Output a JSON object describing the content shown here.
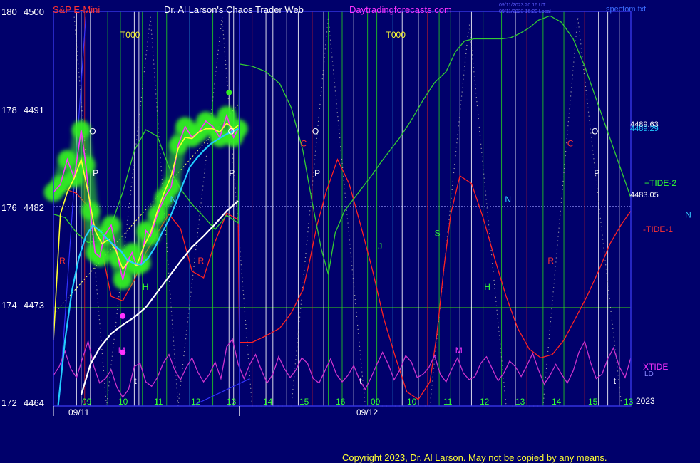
{
  "header": {
    "symbol": "S&P E-Mini",
    "title": "Dr. Al Larson's Chaos Trader Web",
    "site": "Daytradingforecasts.com",
    "stamp_ut": "09/11/2023 20:16 UT",
    "stamp_local": "09/11/2023 16:20 Local",
    "file": "spectom.txt"
  },
  "footer": {
    "copyright": "Copyright 2023, Dr. Al Larson. May not be copied by any means."
  },
  "colors": {
    "background": "#00006b",
    "border": "#3232e0",
    "candle": "#ff33ff",
    "ema_fast": "#ffff33",
    "ema_mid": "#22ccff",
    "ema_slow": "#ffffff",
    "tide1": "#ff2222",
    "tide2": "#33cc33",
    "xtide": "#cc33cc",
    "glow": "#33ee22",
    "grid_green": "#2a9a2a",
    "text_red": "#ff3333",
    "text_green": "#33ff33"
  },
  "chart_data": {
    "type": "line",
    "title": "S&P E-Mini",
    "xlabel": "",
    "ylabel": "",
    "dates": [
      "09/11",
      "09/12"
    ],
    "year": "2023",
    "x_ticks": [
      "09",
      "10",
      "11",
      "12",
      "13",
      "14",
      "15",
      "16",
      "09",
      "10",
      "11",
      "12",
      "13",
      "14",
      "15",
      "13"
    ],
    "x_range": [
      8.0,
      33.0
    ],
    "y_axis": {
      "left_labels": [
        "180",
        "178",
        "176",
        "174",
        "172"
      ],
      "right_labels": [
        "4500",
        "4491",
        "4482",
        "4473",
        "4464"
      ],
      "range": [
        4464,
        4500
      ]
    },
    "horizontal_line": {
      "value": 4482.2,
      "style": "dotted"
    },
    "price_labels": [
      "4489.63",
      "4489.29",
      "4483.05"
    ],
    "series": [
      {
        "name": "",
        "color": "#ff33ff",
        "x": [
          8.0,
          8.3,
          8.6,
          8.9,
          9.2,
          9.4,
          9.6,
          9.8,
          10.0,
          10.2,
          10.5,
          10.8,
          11.0,
          11.2,
          11.4,
          11.6,
          11.8,
          12.0,
          12.2,
          12.5,
          12.8,
          13.1,
          13.4,
          13.7,
          14.0,
          14.3,
          14.6,
          14.9,
          15.2,
          15.5,
          15.8,
          16.0
        ],
        "y": [
          4483.5,
          4484.2,
          4486.5,
          4484.8,
          4489.2,
          4486.0,
          4481.8,
          4478.0,
          4477.6,
          4479.5,
          4480.5,
          4477.5,
          4475.5,
          4477.2,
          4478.0,
          4476.8,
          4477.0,
          4480.0,
          4479.5,
          4481.5,
          4483.0,
          4484.0,
          4487.8,
          4489.5,
          4488.5,
          4489.0,
          4490.0,
          4489.5,
          4488.5,
          4490.5,
          4488.5,
          4489.3
        ]
      },
      {
        "name": "",
        "color": "#ffff33",
        "x": [
          8.0,
          8.3,
          8.6,
          8.9,
          9.2,
          9.5,
          9.8,
          10.1,
          10.4,
          10.7,
          11.0,
          11.3,
          11.6,
          11.9,
          12.2,
          12.5,
          12.8,
          13.1,
          13.4,
          13.7,
          14.0,
          14.3,
          14.6,
          14.9,
          15.2,
          15.5,
          15.8,
          16.0
        ],
        "y": [
          4470.0,
          4481.5,
          4483.5,
          4484.8,
          4486.5,
          4483.5,
          4480.0,
          4478.8,
          4479.2,
          4478.2,
          4476.5,
          4477.3,
          4476.8,
          4478.5,
          4479.8,
          4481.8,
          4483.5,
          4485.0,
          4487.5,
          4488.5,
          4488.4,
          4489.0,
          4489.3,
          4489.3,
          4489.0,
          4489.8,
          4489.3,
          4489.6
        ]
      },
      {
        "name": "",
        "color": "#22ccff",
        "x": [
          8.2,
          8.5,
          8.8,
          9.1,
          9.4,
          9.7,
          10.0,
          10.3,
          10.6,
          10.9,
          11.2,
          11.5,
          11.8,
          12.1,
          12.4,
          12.7,
          13.0,
          13.3,
          13.6,
          13.9,
          14.2,
          14.5,
          14.8,
          15.1,
          15.4,
          15.7,
          16.0
        ],
        "y": [
          4464.0,
          4470.0,
          4474.5,
          4477.5,
          4479.5,
          4480.5,
          4480.0,
          4479.3,
          4478.7,
          4478.2,
          4477.3,
          4477.0,
          4476.9,
          4477.5,
          4478.5,
          4479.8,
          4481.0,
          4482.5,
          4484.2,
          4485.8,
          4486.6,
          4487.3,
          4487.9,
          4488.3,
          4488.7,
          4489.0,
          4489.3
        ]
      },
      {
        "name": "",
        "color": "#ffffff",
        "x": [
          9.2,
          9.6,
          10.0,
          10.5,
          11.0,
          11.5,
          12.0,
          12.5,
          13.0,
          13.5,
          14.0,
          14.5,
          15.0,
          15.5,
          16.0
        ],
        "y": [
          4465.0,
          4467.8,
          4469.3,
          4470.6,
          4471.4,
          4472.1,
          4473.0,
          4474.4,
          4475.8,
          4477.2,
          4478.5,
          4479.5,
          4480.6,
          4481.8,
          4482.7
        ]
      },
      {
        "name": "-TIDE-1",
        "color": "#ff2222",
        "x": [
          8.0,
          8.5,
          9.0,
          9.5,
          10.0,
          10.5,
          11.0,
          11.5,
          12.0,
          12.5,
          13.0,
          13.5,
          14.0,
          14.5,
          15.0,
          15.5,
          16.0,
          16.05,
          16.6,
          17.2,
          17.8,
          18.3,
          18.8,
          19.1,
          19.4,
          19.8,
          20.3,
          20.8,
          21.3,
          21.8,
          22.3,
          22.8,
          23.3,
          23.8,
          24.3,
          24.6,
          24.9,
          25.2,
          25.6,
          26.1,
          26.6,
          27.1,
          27.6,
          28.1,
          28.6,
          29.1,
          29.6,
          30.1,
          30.6,
          31.1,
          31.6,
          32.1,
          32.6,
          33.0
        ],
        "y": [
          4483.2,
          4483.8,
          4483.4,
          4482.2,
          4479.2,
          4474.0,
          4473.6,
          4475.5,
          4478.0,
          4479.8,
          4481.5,
          4480.2,
          4476.3,
          4475.7,
          4479.0,
          4481.6,
          4481.0,
          4469.8,
          4469.8,
          4470.4,
          4471.1,
          4472.5,
          4474.6,
          4477.3,
          4480.4,
          4483.5,
          4486.5,
          4484.3,
          4480.5,
          4476.5,
          4472.0,
          4468.5,
          4465.3,
          4464.6,
          4466.2,
          4470.5,
          4476.5,
          4481.5,
          4485.0,
          4484.3,
          4481.2,
          4477.5,
          4474.0,
          4471.1,
          4469.2,
          4468.4,
          4468.7,
          4470.0,
          4472.0,
          4474.0,
          4476.3,
          4478.8,
          4480.6,
          4481.8
        ]
      },
      {
        "name": "+TIDE-2",
        "color": "#33cc33",
        "x": [
          8.0,
          8.5,
          9.0,
          9.5,
          10.0,
          10.5,
          11.0,
          11.5,
          12.0,
          12.5,
          13.0,
          13.5,
          14.0,
          14.5,
          15.0,
          15.5,
          16.0,
          16.05,
          16.6,
          17.2,
          17.8,
          18.3,
          18.8,
          19.2,
          19.6,
          19.9,
          20.2,
          20.6,
          21.0,
          21.4,
          21.8,
          22.2,
          22.6,
          23.0,
          23.5,
          24.0,
          24.5,
          25.0,
          25.4,
          25.8,
          26.2,
          26.6,
          27.0,
          27.4,
          27.8,
          28.2,
          28.6,
          29.0,
          29.5,
          30.0,
          30.5,
          31.0,
          31.5,
          32.0,
          32.5,
          33.0
        ],
        "y": [
          4481.5,
          4481.2,
          4479.8,
          4478.9,
          4479.1,
          4480.5,
          4483.5,
          4487.3,
          4489.2,
          4488.6,
          4485.8,
          4483.8,
          4482.4,
          4481.3,
          4480.1,
          4481.4,
          4480.7,
          4495.2,
          4495.0,
          4494.5,
          4493.4,
          4491.2,
          4487.3,
          4482.6,
          4478.3,
          4476.0,
          4479.8,
          4481.8,
          4482.9,
          4484.0,
          4485.1,
          4486.3,
          4487.4,
          4488.5,
          4490.1,
          4491.9,
          4493.5,
          4494.5,
          4496.3,
          4497.3,
          4497.5,
          4497.5,
          4497.5,
          4497.5,
          4497.6,
          4498.0,
          4498.5,
          4499.2,
          4499.6,
          4499.0,
          4497.5,
          4495.0,
          4492.0,
          4489.0,
          4486.0,
          4483.0
        ]
      },
      {
        "name": "XTIDE",
        "color": "#cc33cc",
        "x": [
          8.0,
          8.25,
          8.5,
          8.75,
          9.0,
          9.25,
          9.5,
          9.75,
          10.0,
          10.25,
          10.5,
          10.75,
          11.0,
          11.25,
          11.5,
          11.75,
          12.0,
          12.25,
          12.5,
          12.75,
          13.0,
          13.25,
          13.5,
          13.75,
          14.0,
          14.25,
          14.5,
          14.75,
          15.0,
          15.25,
          15.5,
          15.75,
          16.0,
          16.25,
          16.5,
          16.75,
          17.0,
          17.25,
          17.5,
          17.75,
          18.0,
          18.25,
          18.5,
          18.75,
          19.0,
          19.25,
          19.5,
          19.75,
          20.0,
          20.25,
          20.5,
          20.75,
          21.0,
          21.25,
          21.5,
          21.75,
          22.0,
          22.25,
          22.5,
          22.75,
          23.0,
          23.25,
          23.5,
          23.75,
          24.0,
          24.25,
          24.5,
          24.75,
          25.0,
          25.25,
          25.5,
          25.75,
          26.0,
          26.25,
          26.5,
          26.75,
          27.0,
          27.25,
          27.5,
          27.75,
          28.0,
          28.25,
          28.5,
          28.75,
          29.0,
          29.25,
          29.5,
          29.75,
          30.0,
          30.25,
          30.5,
          30.75,
          31.0,
          31.25,
          31.5,
          31.75,
          32.0,
          32.25,
          32.5,
          32.75,
          33.0
        ],
        "y": [
          4466.8,
          4467.6,
          4469.0,
          4467.4,
          4466.6,
          4468.3,
          4469.9,
          4467.6,
          4466.1,
          4466.5,
          4467.3,
          4465.7,
          4464.8,
          4465.5,
          4467.6,
          4467.9,
          4466.2,
          4465.8,
          4466.6,
          4467.9,
          4468.7,
          4467.3,
          4466.4,
          4467.5,
          4468.4,
          4467.1,
          4466.2,
          4466.9,
          4468.0,
          4466.5,
          4469.4,
          4470.1,
          4467.8,
          4466.5,
          4467.8,
          4468.7,
          4467.3,
          4466.1,
          4466.9,
          4468.5,
          4467.4,
          4466.6,
          4467.3,
          4468.4,
          4467.9,
          4466.5,
          4466.1,
          4467.2,
          4468.3,
          4466.9,
          4466.2,
          4466.8,
          4467.7,
          4466.4,
          4465.5,
          4466.6,
          4467.8,
          4468.9,
          4467.8,
          4466.4,
          4467.3,
          4468.6,
          4468.0,
          4466.6,
          4466.9,
          4467.5,
          4468.6,
          4466.9,
          4466.2,
          4467.4,
          4468.4,
          4467.0,
          4466.4,
          4466.7,
          4467.9,
          4468.5,
          4467.4,
          4466.3,
          4467.0,
          4468.1,
          4467.6,
          4466.7,
          4467.7,
          4468.8,
          4467.3,
          4466.0,
          4466.8,
          4467.8,
          4466.9,
          4466.1,
          4467.2,
          4468.9,
          4469.9,
          4468.0,
          4466.5,
          4466.9,
          4468.3,
          4469.3,
          4467.6,
          4466.6,
          4468.4
        ]
      }
    ],
    "vertical_markers": [
      {
        "x": 9.0,
        "color": "#ffffff"
      },
      {
        "x": 9.2,
        "color": "#ffffff"
      },
      {
        "x": 9.35,
        "color": "#dd2222"
      },
      {
        "x": 9.6,
        "color": "#ffffff"
      },
      {
        "x": 10.35,
        "color": "#22cc22"
      },
      {
        "x": 10.9,
        "color": "#22cc22"
      },
      {
        "x": 11.5,
        "color": "#ffffff"
      },
      {
        "x": 11.7,
        "color": "#ffffff"
      },
      {
        "x": 11.85,
        "color": "#22cc22"
      },
      {
        "x": 12.5,
        "color": "#22cc22"
      },
      {
        "x": 12.9,
        "color": "#22cc22"
      },
      {
        "x": 13.9,
        "color": "#33ccff"
      },
      {
        "x": 14.9,
        "color": "#22cc22"
      },
      {
        "x": 15.6,
        "color": "#ffffff"
      },
      {
        "x": 15.8,
        "color": "#ffffff"
      },
      {
        "x": 16.6,
        "color": "#dd2222"
      },
      {
        "x": 17.2,
        "color": "#ffffff"
      },
      {
        "x": 17.5,
        "color": "#ffffff"
      },
      {
        "x": 18.1,
        "color": "#ffffff"
      },
      {
        "x": 18.6,
        "color": "#ffffff"
      },
      {
        "x": 19.2,
        "color": "#dd2222"
      },
      {
        "x": 19.7,
        "color": "#ffffff"
      },
      {
        "x": 19.9,
        "color": "#22cc22"
      },
      {
        "x": 20.5,
        "color": "#22cc22"
      },
      {
        "x": 21.0,
        "color": "#ffffff"
      },
      {
        "x": 21.6,
        "color": "#22cc22"
      },
      {
        "x": 22.0,
        "color": "#22cc22"
      },
      {
        "x": 22.7,
        "color": "#33ccff"
      },
      {
        "x": 23.1,
        "color": "#ffffff"
      },
      {
        "x": 23.8,
        "color": "#ffffff"
      },
      {
        "x": 24.2,
        "color": "#dd2222"
      },
      {
        "x": 24.7,
        "color": "#22cc22"
      },
      {
        "x": 25.2,
        "color": "#22cc22"
      },
      {
        "x": 25.6,
        "color": "#ffffff"
      },
      {
        "x": 26.1,
        "color": "#ffffff"
      },
      {
        "x": 26.6,
        "color": "#22cc22"
      },
      {
        "x": 27.4,
        "color": "#22cc22"
      },
      {
        "x": 28.0,
        "color": "#ffffff"
      },
      {
        "x": 28.5,
        "color": "#dd2222"
      },
      {
        "x": 29.2,
        "color": "#22cc22"
      },
      {
        "x": 30.1,
        "color": "#22cc22"
      },
      {
        "x": 31.0,
        "color": "#dd2222"
      },
      {
        "x": 31.6,
        "color": "#ffffff"
      },
      {
        "x": 32.0,
        "color": "#ffffff"
      },
      {
        "x": 32.5,
        "color": "#ffffff"
      }
    ],
    "annotations": [
      {
        "text": "T000",
        "x": 10.9,
        "y": 4497.6,
        "color": "#ffff33"
      },
      {
        "text": "T000",
        "x": 22.4,
        "y": 4497.6,
        "color": "#ffff33"
      },
      {
        "text": "O",
        "x": 9.55,
        "y": 4488.8,
        "color": "#ffffff"
      },
      {
        "text": "P",
        "x": 9.7,
        "y": 4485.0,
        "color": "#ffffff"
      },
      {
        "text": "O",
        "x": 15.55,
        "y": 4488.8,
        "color": "#ffffff"
      },
      {
        "text": "P",
        "x": 15.6,
        "y": 4485.0,
        "color": "#ffffff"
      },
      {
        "text": "O",
        "x": 19.2,
        "y": 4488.8,
        "color": "#ffffff"
      },
      {
        "text": "P",
        "x": 19.3,
        "y": 4485.0,
        "color": "#ffffff"
      },
      {
        "text": "O",
        "x": 31.3,
        "y": 4488.8,
        "color": "#ffffff"
      },
      {
        "text": "P",
        "x": 31.4,
        "y": 4485.0,
        "color": "#ffffff"
      },
      {
        "text": "C",
        "x": 18.7,
        "y": 4487.7,
        "color": "#ff3333"
      },
      {
        "text": "C",
        "x": 30.25,
        "y": 4487.7,
        "color": "#ff3333"
      },
      {
        "text": "R",
        "x": 8.25,
        "y": 4477.0,
        "color": "#ff3333"
      },
      {
        "text": "R",
        "x": 14.25,
        "y": 4477.0,
        "color": "#ff3333"
      },
      {
        "text": "R",
        "x": 29.4,
        "y": 4477.0,
        "color": "#ff3333"
      },
      {
        "text": "N",
        "x": 13.05,
        "y": 4482.6,
        "color": "#33ccff"
      },
      {
        "text": "N",
        "x": 27.55,
        "y": 4482.6,
        "color": "#33ccff"
      },
      {
        "text": "N",
        "x": 35.35,
        "y": 4481.2,
        "color": "#33ccff"
      },
      {
        "text": "S",
        "x": 9.95,
        "y": 4479.5,
        "color": "#33ff33"
      },
      {
        "text": "S",
        "x": 24.5,
        "y": 4479.5,
        "color": "#33ff33"
      },
      {
        "text": "J",
        "x": 22.05,
        "y": 4478.3,
        "color": "#33ff33"
      },
      {
        "text": "H",
        "x": 11.85,
        "y": 4474.6,
        "color": "#33ff33"
      },
      {
        "text": "H",
        "x": 26.65,
        "y": 4474.6,
        "color": "#33ff33"
      },
      {
        "text": "M",
        "x": 10.8,
        "y": 4468.8,
        "color": "#ff33ff"
      },
      {
        "text": "M",
        "x": 25.4,
        "y": 4468.8,
        "color": "#ff33ff"
      },
      {
        "text": "t",
        "x": 11.5,
        "y": 4466.0,
        "color": "#ffffff"
      },
      {
        "text": "t",
        "x": 21.25,
        "y": 4466.0,
        "color": "#ffffff"
      },
      {
        "text": "t",
        "x": 32.25,
        "y": 4466.0,
        "color": "#ffffff"
      }
    ],
    "legend": [
      {
        "name": "+TIDE-2",
        "color": "#33ff33"
      },
      {
        "name": "-TIDE-1",
        "color": "#ff3333"
      },
      {
        "name": "XTIDE",
        "color": "#ff33ff"
      },
      {
        "name": "LD",
        "color": "#8888ff"
      }
    ]
  }
}
